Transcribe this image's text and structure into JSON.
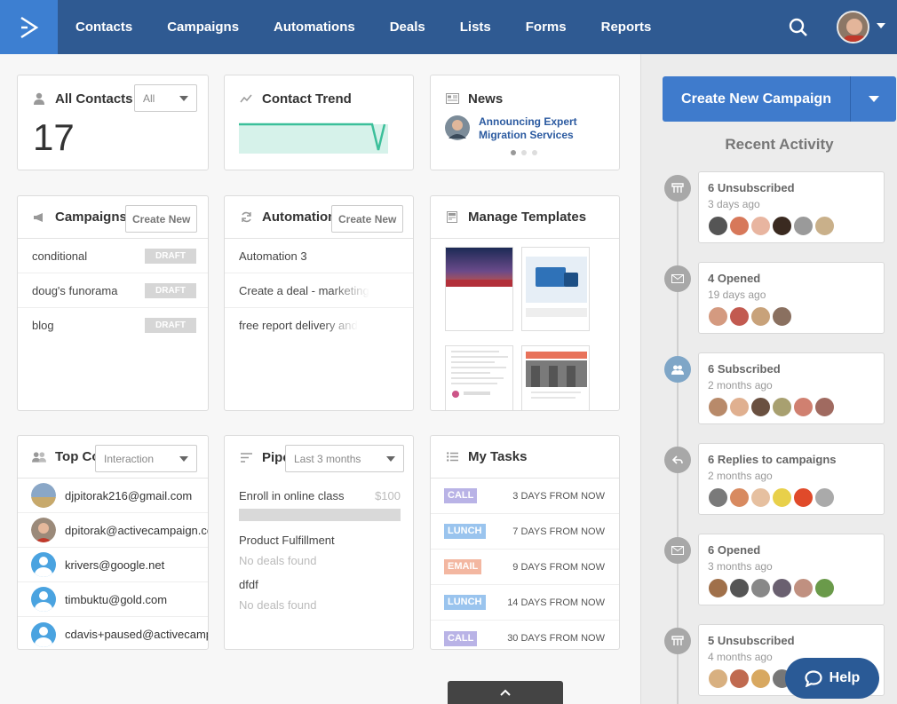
{
  "nav": {
    "items": [
      "Contacts",
      "Campaigns",
      "Automations",
      "Deals",
      "Lists",
      "Forms",
      "Reports"
    ]
  },
  "all_contacts": {
    "title": "All Contacts",
    "filter": "All",
    "count": "17"
  },
  "contact_trend": {
    "title": "Contact Trend"
  },
  "news": {
    "title": "News",
    "headline_line1": "Announcing Expert",
    "headline_line2": "Migration Services"
  },
  "campaigns": {
    "title": "Campaigns",
    "create_label": "Create New",
    "items": [
      {
        "name": "conditional",
        "status": "DRAFT"
      },
      {
        "name": "doug's funorama",
        "status": "DRAFT"
      },
      {
        "name": "blog",
        "status": "DRAFT"
      }
    ]
  },
  "automations": {
    "title": "Automations",
    "create_label": "Create New",
    "items": [
      "Automation 3",
      "Create a deal - marketing",
      "free report delivery and"
    ]
  },
  "templates": {
    "title": "Manage Templates"
  },
  "top_contacts": {
    "title": "Top Contacts",
    "filter": "Interaction",
    "items": [
      "djpitorak216@gmail.com",
      "dpitorak@activecampaign.com",
      "krivers@google.net",
      "timbuktu@gold.com",
      "cdavis+paused@activecampaign.com"
    ]
  },
  "pipeline": {
    "title": "Pipelines",
    "filter": "Last 3 months",
    "items": [
      {
        "name": "Enroll in online class",
        "value": "$100",
        "empty": ""
      },
      {
        "name": "Product Fulfillment",
        "value": "",
        "empty": "No deals found"
      },
      {
        "name": "dfdf",
        "value": "",
        "empty": "No deals found"
      }
    ]
  },
  "tasks": {
    "title": "My Tasks",
    "items": [
      {
        "type": "CALL",
        "due": "3 DAYS FROM NOW",
        "color": "#b9b3e6"
      },
      {
        "type": "LUNCH",
        "due": "7 DAYS FROM NOW",
        "color": "#9ac4ee"
      },
      {
        "type": "EMAIL",
        "due": "9 DAYS FROM NOW",
        "color": "#f3b7a1"
      },
      {
        "type": "LUNCH",
        "due": "14 DAYS FROM NOW",
        "color": "#9ac4ee"
      },
      {
        "type": "CALL",
        "due": "30 DAYS FROM NOW",
        "color": "#b9b3e6"
      }
    ]
  },
  "right": {
    "create_campaign": "Create New Campaign",
    "recent_activity": "Recent Activity",
    "activities": [
      {
        "title": "6 Unsubscribed",
        "time": "3 days ago",
        "icon": "unsubscribe-icon"
      },
      {
        "title": "4 Opened",
        "time": "19 days ago",
        "icon": "envelope-icon"
      },
      {
        "title": "6 Subscribed",
        "time": "2 months ago",
        "icon": "users-icon"
      },
      {
        "title": "6 Replies to campaigns",
        "time": "2 months ago",
        "icon": "reply-icon"
      },
      {
        "title": "6 Opened",
        "time": "3 months ago",
        "icon": "envelope-icon"
      },
      {
        "title": "5 Unsubscribed",
        "time": "4 months ago",
        "icon": "unsubscribe-icon"
      }
    ]
  },
  "help": {
    "label": "Help"
  },
  "colors": {
    "nav": "#2f5a92",
    "accent": "#3f7bcc",
    "trend": "#3bbf9a"
  }
}
